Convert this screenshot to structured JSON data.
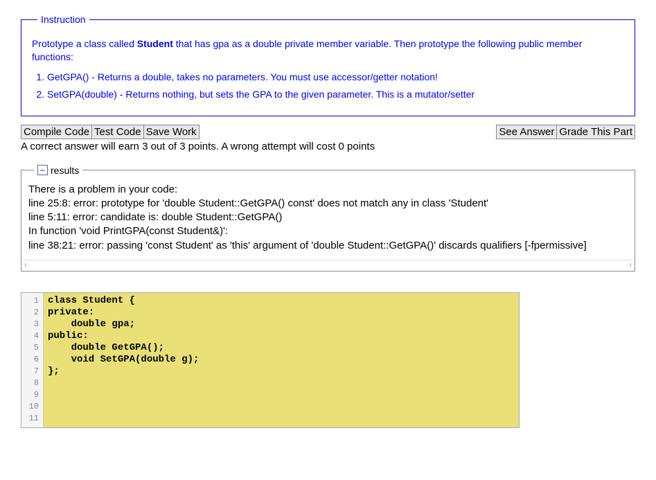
{
  "instruction": {
    "legend": "Instruction",
    "intro_before": "Prototype a class called ",
    "intro_bold": "Student",
    "intro_after": " that has gpa as a double private member variable. Then prototype the following public member functions:",
    "list": [
      "GetGPA() - Returns a double, takes no parameters. You must use accessor/getter notation!",
      "SetGPA(double) - Returns nothing, but sets the GPA to the given parameter. This is a mutator/setter"
    ]
  },
  "buttons": {
    "compile": "Compile Code",
    "test": "Test Code",
    "save": "Save Work",
    "see_answer": "See Answer",
    "grade": "Grade This Part"
  },
  "hint": "A correct answer will earn 3 out of 3 points. A wrong attempt will cost 0 points",
  "results": {
    "legend": "results",
    "body": "There is a problem in your code:\nline 25:8: error: prototype for 'double Student::GetGPA() const' does not match any in class 'Student'\nline 5:11: error: candidate is: double Student::GetGPA()\nIn function 'void PrintGPA(const Student&)':\nline 38:21: error: passing 'const Student' as 'this' argument of 'double Student::GetGPA()' discards qualifiers [-fpermissive]"
  },
  "editor": {
    "lines": [
      "class Student {",
      "private:",
      "    double gpa;",
      "public:",
      "    double GetGPA();",
      "    void SetGPA(double g);",
      "};",
      "",
      "",
      "",
      ""
    ]
  }
}
